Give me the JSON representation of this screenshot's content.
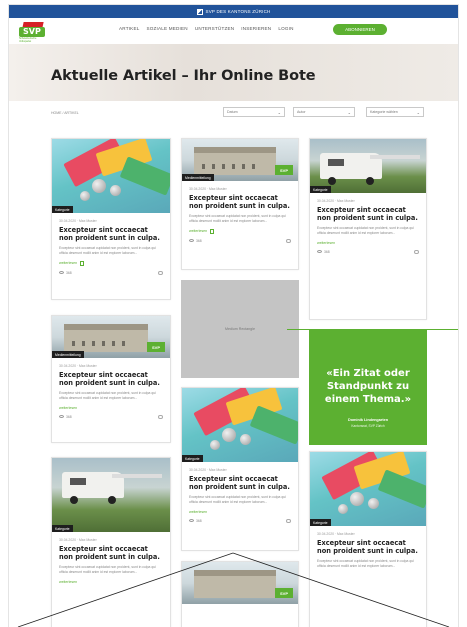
{
  "topbar": {
    "text": "SVP DES KANTONS ZÜRICH"
  },
  "logo": {
    "text": "SVP",
    "subtext": "Schweizerische Volkspartei"
  },
  "nav": {
    "items": [
      "ARTIKEL",
      "SOZIALE MEDIEN",
      "UNTERSTÜTZEN",
      "INSERIEREN",
      "LOGIN"
    ],
    "cta": "ABONNIEREN"
  },
  "hero": {
    "title": "Aktuelle Artikel – Ihr Online Bote"
  },
  "breadcrumb": "HOME / ARTIKEL",
  "filters": {
    "date": "Datum",
    "author": "Autor",
    "category": "Kategorie wählen"
  },
  "article": {
    "meta": "30.04.2020 · Max Muster",
    "title": "Excepteur sint occaecat non proident sunt in culpa.",
    "excerpt": "Excepteur sint occaecat cupidatat non proident, sunt in culpa qui officia deserunt mollit anim id est explorer laborum...",
    "more": "weiterlesen",
    "views": "368"
  },
  "tags": {
    "kategorie": "Kategorie",
    "medien": "Medienmitteilung"
  },
  "ad_label": "Medium Rectangle",
  "quote": {
    "text": "«Ein Zitat oder Standpunkt zu einem Thema.»",
    "author": "Dominik Lindengarten",
    "role": "Kantonsrat, SVP Zürich"
  },
  "colors": {
    "brand_green": "#5cb031",
    "brand_blue": "#21539a",
    "brand_red": "#d62027"
  }
}
